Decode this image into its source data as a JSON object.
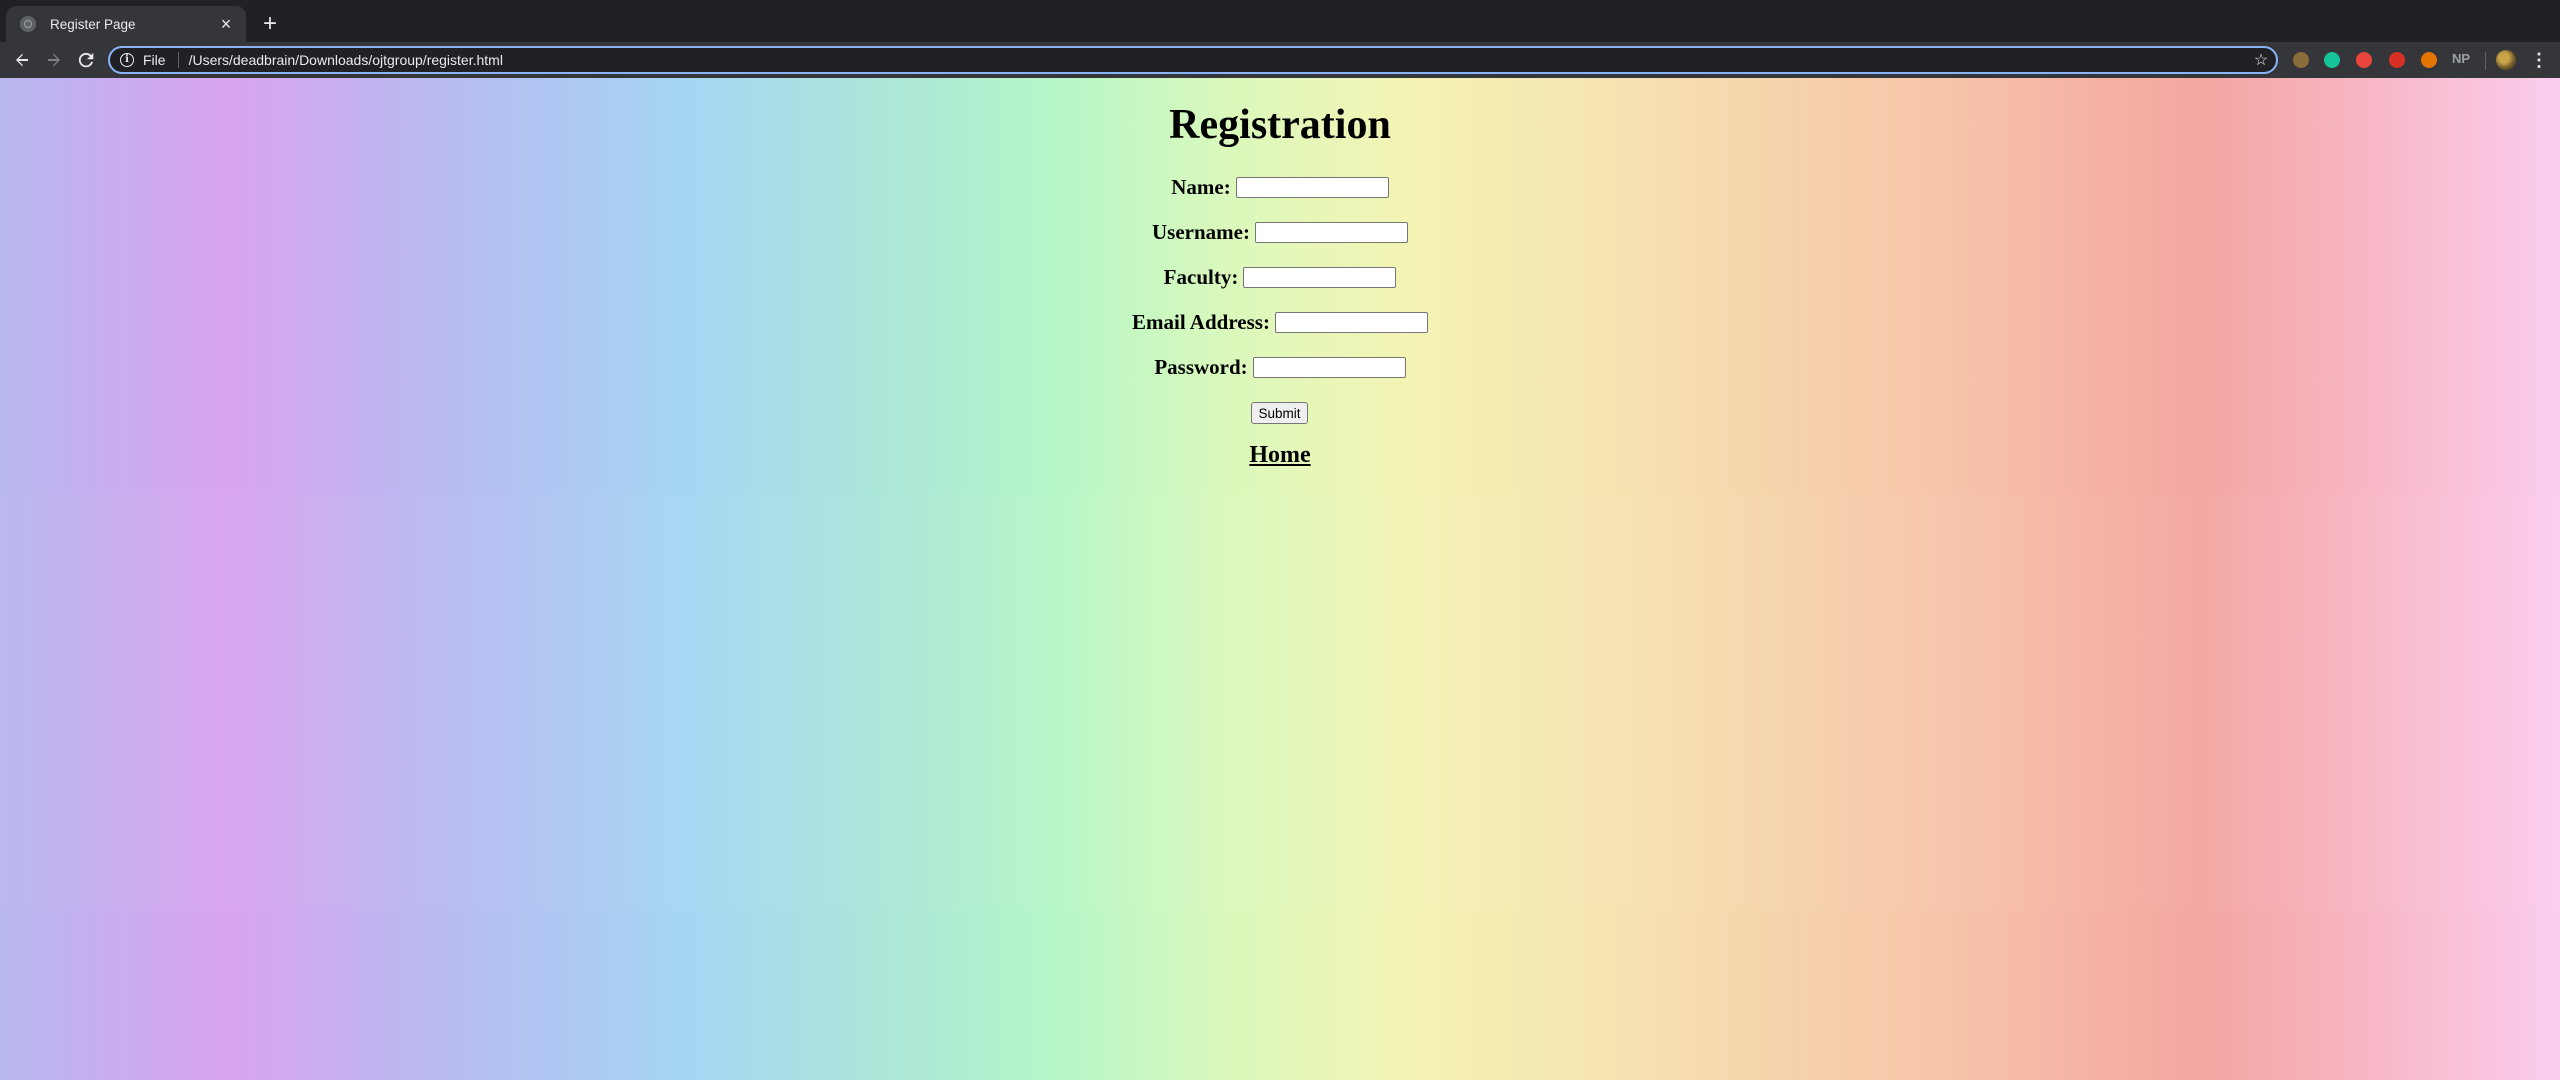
{
  "browser": {
    "tab_title": "Register Page",
    "tab_close": "×",
    "new_tab": "+",
    "url_scheme": "File",
    "url": "/Users/deadbrain/Downloads/ojtgroup/register.html",
    "extensions": [
      {
        "name": "extension-1-icon",
        "color": "#8a6d3b"
      },
      {
        "name": "grammarly-icon",
        "color": "#15c39a"
      },
      {
        "name": "extension-3-icon",
        "color": "#e8453c"
      },
      {
        "name": "extension-4-icon",
        "color": "#d93025"
      },
      {
        "name": "extension-5-icon",
        "color": "#e37400"
      }
    ],
    "np_label": "NP",
    "menu": "⋮"
  },
  "page": {
    "heading": "Registration",
    "fields": [
      {
        "label": "Name:",
        "value": ""
      },
      {
        "label": "Username:",
        "value": ""
      },
      {
        "label": "Faculty:",
        "value": ""
      },
      {
        "label": "Email Address:",
        "value": ""
      },
      {
        "label": "Password:",
        "value": ""
      }
    ],
    "submit_label": "Submit",
    "home_link": "Home"
  }
}
